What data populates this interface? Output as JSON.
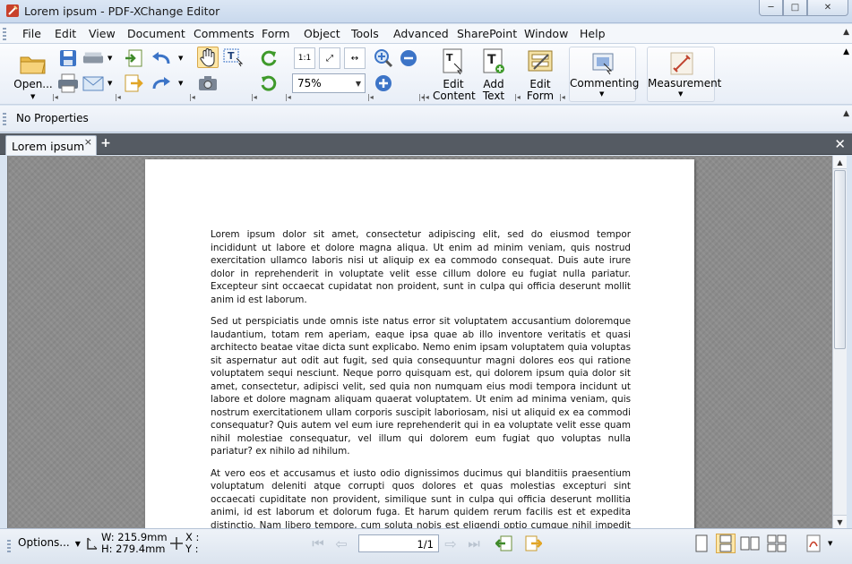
{
  "window": {
    "title": "Lorem ipsum - PDF-XChange Editor",
    "minimize_glyph": "─",
    "maximize_glyph": "□",
    "close_glyph": "✕"
  },
  "menu": {
    "items": [
      "File",
      "Edit",
      "View",
      "Document",
      "Comments",
      "Form",
      "Object",
      "Tools",
      "Advanced",
      "SharePoint",
      "Window",
      "Help"
    ]
  },
  "toolbar": {
    "open_label": "Open...",
    "zoom_value": "75%",
    "edit_content_label_1": "Edit",
    "edit_content_label_2": "Content",
    "add_text_label_1": "Add",
    "add_text_label_2": "Text",
    "edit_form_label_1": "Edit",
    "edit_form_label_2": "Form",
    "commenting_label": "Commenting",
    "measurement_label": "Measurement"
  },
  "properties": {
    "text": "No Properties"
  },
  "tabs": {
    "active_tab": "Lorem ipsum",
    "close_glyph": "×",
    "new_tab_glyph": "+",
    "close_all_glyph": "✕"
  },
  "document": {
    "paragraphs": [
      "Lorem ipsum dolor sit amet, consectetur adipiscing elit, sed do eiusmod tempor incididunt ut labore et dolore magna aliqua. Ut enim ad minim veniam, quis nostrud exercitation ullamco laboris nisi ut aliquip ex ea commodo consequat. Duis aute irure dolor in reprehenderit in voluptate velit esse cillum dolore eu fugiat nulla pariatur. Excepteur sint occaecat cupidatat non proident, sunt in culpa qui officia deserunt mollit anim id est laborum.",
      "Sed ut perspiciatis unde omnis iste natus error sit voluptatem accusantium doloremque laudantium, totam rem aperiam, eaque ipsa quae ab illo inventore veritatis et quasi architecto beatae vitae dicta sunt explicabo. Nemo enim ipsam voluptatem quia voluptas sit aspernatur aut odit aut fugit, sed quia consequuntur magni dolores eos qui ratione voluptatem sequi nesciunt. Neque porro quisquam est, qui dolorem ipsum quia dolor sit amet, consectetur, adipisci velit, sed quia non numquam eius modi tempora incidunt ut labore et dolore magnam aliquam quaerat voluptatem. Ut enim ad minima veniam, quis nostrum exercitationem ullam corporis suscipit laboriosam, nisi ut aliquid ex ea commodi consequatur? Quis autem vel eum iure reprehenderit qui in ea voluptate velit esse quam nihil molestiae consequatur, vel illum qui dolorem eum fugiat quo voluptas nulla pariatur? ex nihilo ad nihilum.",
      "At vero eos et accusamus et iusto odio dignissimos ducimus qui blanditiis praesentium voluptatum deleniti atque corrupti quos dolores et quas molestias excepturi sint occaecati cupiditate non provident, similique sunt in culpa qui officia deserunt mollitia animi, id est laborum et dolorum fuga. Et harum quidem rerum facilis est et expedita distinctio. Nam libero tempore, cum soluta nobis est eligendi optio cumque nihil impedit quo minus id quod maxime placeat facere possimus, omnis voluptas assumenda est, omnis dolor repellendus. Temporibus autem quibusdam et aut officiis debitis aut rerum necessitatibus saepe eveniet ut et voluptates"
    ]
  },
  "status": {
    "options_label": "Options...",
    "width": "W: 215.9mm",
    "height": "H: 279.4mm",
    "x_label": "X :",
    "y_label": "Y :",
    "page_indicator": "1/1"
  },
  "colors": {
    "accent": "#3c74c7",
    "doc_background": "#8c8c8c",
    "tab_strip": "#555b63"
  }
}
